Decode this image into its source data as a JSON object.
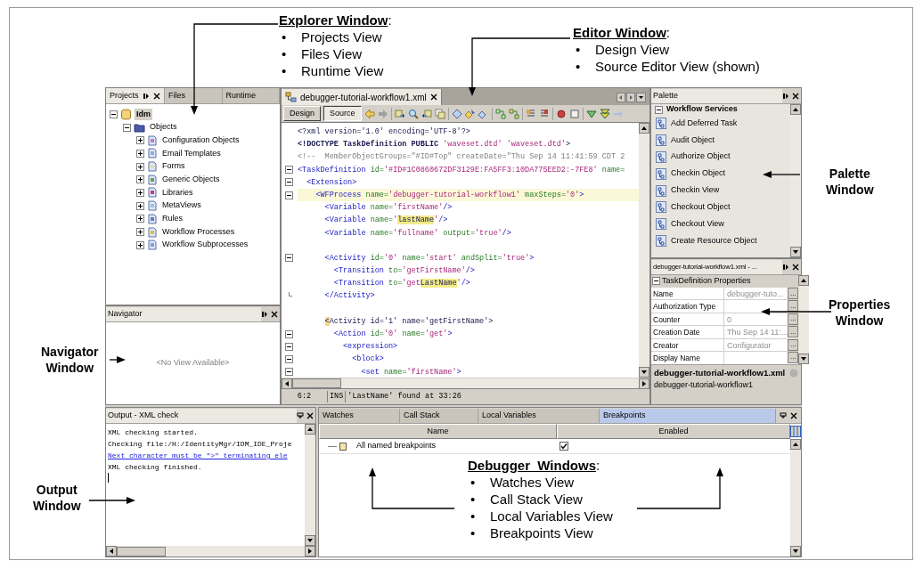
{
  "explorer": {
    "tabs": [
      {
        "label": "Projects",
        "selected": true
      },
      {
        "label": "Files",
        "selected": false
      },
      {
        "label": "Runtime",
        "selected": false
      }
    ],
    "tree": [
      {
        "label": "Idm",
        "expanded": true,
        "selected": true,
        "children": [
          {
            "label": "Objects",
            "expanded": true,
            "selected": false,
            "children": [
              {
                "label": "Configuration Objects",
                "expanded": false,
                "selected": false
              },
              {
                "label": "Email Templates",
                "expanded": false,
                "selected": false
              },
              {
                "label": "Forms",
                "expanded": false,
                "selected": false
              },
              {
                "label": "Generic Objects",
                "expanded": false,
                "selected": false
              },
              {
                "label": "Libraries",
                "expanded": false,
                "selected": false
              },
              {
                "label": "MetaViews",
                "expanded": false,
                "selected": false
              },
              {
                "label": "Rules",
                "expanded": false,
                "selected": false
              },
              {
                "label": "Workflow Processes",
                "expanded": false,
                "selected": false
              },
              {
                "label": "Workflow Subprocesses",
                "expanded": false,
                "selected": false
              }
            ]
          }
        ]
      }
    ]
  },
  "navigator": {
    "title": "Navigator",
    "empty_text": "<No View Available>"
  },
  "editor": {
    "file_tab": "debugger-tutorial-workflow1.xml",
    "view_tabs": [
      {
        "label": "Design",
        "selected": false
      },
      {
        "label": "Source",
        "selected": true
      }
    ],
    "lines": [
      {
        "tokens": [
          {
            "kind": "pi",
            "text": "<?xml version='1.0' encoding='UTF-8'?>"
          }
        ]
      },
      {
        "tokens": [
          {
            "kind": "doctype",
            "text": "<!DOCTYPE TaskDefinition PUBLIC "
          },
          {
            "kind": "value",
            "text": "'waveset.dtd' 'waveset.dtd'"
          },
          {
            "kind": "pi",
            "text": ">"
          }
        ]
      },
      {
        "tokens": [
          {
            "kind": "comment",
            "text": "<!--  MemberObjectGroups=\"#ID#Top\" createDate=\"Thu Sep 14 11:41:59 CDT 2"
          }
        ]
      },
      {
        "expanded": true,
        "tokens": [
          {
            "kind": "tag",
            "text": "<TaskDefinition"
          },
          {
            "kind": "attr",
            "text": " id="
          },
          {
            "kind": "value",
            "text": "'#ID#1C0860672DF3129E:FA5FF3:10DA775EED2:-7FE8'"
          },
          {
            "kind": "attr",
            "text": " name="
          }
        ]
      },
      {
        "expanded": true,
        "tokens": [
          {
            "kind": "tag",
            "text": "  <Extension>"
          }
        ]
      },
      {
        "expanded": true,
        "highlighted": true,
        "tokens": [
          {
            "kind": "tag",
            "text": "    <WFProcess"
          },
          {
            "kind": "attr",
            "text": " name="
          },
          {
            "kind": "value",
            "text": "'debugger-tutorial-workflow1'"
          },
          {
            "kind": "attr",
            "text": " maxSteps="
          },
          {
            "kind": "value",
            "text": "'0'"
          },
          {
            "kind": "tag",
            "text": ">"
          }
        ]
      },
      {
        "tokens": [
          {
            "kind": "tag",
            "text": "      <Variable"
          },
          {
            "kind": "attr",
            "text": " name="
          },
          {
            "kind": "value",
            "text": "'firstName'"
          },
          {
            "kind": "tag",
            "text": "/>"
          }
        ]
      },
      {
        "tokens": [
          {
            "kind": "tag",
            "text": "      <Variable"
          },
          {
            "kind": "attr",
            "text": " name="
          },
          {
            "kind": "value",
            "text": "'"
          },
          {
            "kind": "match",
            "text": "lastName"
          },
          {
            "kind": "value",
            "text": "'"
          },
          {
            "kind": "tag",
            "text": "/>"
          }
        ]
      },
      {
        "tokens": [
          {
            "kind": "tag",
            "text": "      <Variable"
          },
          {
            "kind": "attr",
            "text": " name="
          },
          {
            "kind": "value",
            "text": "'fullname'"
          },
          {
            "kind": "attr",
            "text": " output="
          },
          {
            "kind": "value",
            "text": "'true'"
          },
          {
            "kind": "tag",
            "text": "/>"
          }
        ]
      },
      {
        "expanded": true,
        "space_before": true,
        "tokens": [
          {
            "kind": "tag",
            "text": "      <Activity"
          },
          {
            "kind": "attr",
            "text": " id="
          },
          {
            "kind": "value",
            "text": "'0'"
          },
          {
            "kind": "attr",
            "text": " name="
          },
          {
            "kind": "value",
            "text": "'start'"
          },
          {
            "kind": "attr",
            "text": " andSplit="
          },
          {
            "kind": "value",
            "text": "'true'"
          },
          {
            "kind": "tag",
            "text": ">"
          }
        ]
      },
      {
        "tokens": [
          {
            "kind": "tag",
            "text": "        <Transition"
          },
          {
            "kind": "attr",
            "text": " to="
          },
          {
            "kind": "value",
            "text": "'getFirstName'"
          },
          {
            "kind": "tag",
            "text": "/>"
          }
        ]
      },
      {
        "tokens": [
          {
            "kind": "tag",
            "text": "        <Transition"
          },
          {
            "kind": "attr",
            "text": " to="
          },
          {
            "kind": "value",
            "text": "'get"
          },
          {
            "kind": "match",
            "text": "LastName"
          },
          {
            "kind": "value",
            "text": "'"
          },
          {
            "kind": "tag",
            "text": "/>"
          }
        ]
      },
      {
        "block_end": true,
        "tokens": [
          {
            "kind": "tag",
            "text": "      </Activity>"
          }
        ]
      },
      {
        "space_before": true,
        "tokens": [
          {
            "kind": "cursor",
            "text": "      <"
          },
          {
            "kind": "pi",
            "text": "Activity id="
          },
          {
            "kind": "pi",
            "text": "'1' name='getFirstName'>"
          }
        ]
      },
      {
        "expanded": true,
        "tokens": [
          {
            "kind": "tag",
            "text": "        <Action"
          },
          {
            "kind": "attr",
            "text": " id="
          },
          {
            "kind": "value",
            "text": "'0'"
          },
          {
            "kind": "attr",
            "text": " name="
          },
          {
            "kind": "value",
            "text": "'get'"
          },
          {
            "kind": "tag",
            "text": ">"
          }
        ]
      },
      {
        "expanded": true,
        "tokens": [
          {
            "kind": "tag",
            "text": "          <expression>"
          }
        ]
      },
      {
        "expanded": true,
        "tokens": [
          {
            "kind": "tag",
            "text": "            <block>"
          }
        ]
      },
      {
        "expanded": true,
        "tokens": [
          {
            "kind": "tag",
            "text": "              <set"
          },
          {
            "kind": "attr",
            "text": " name="
          },
          {
            "kind": "value",
            "text": "'firstName'"
          },
          {
            "kind": "tag",
            "text": ">"
          }
        ]
      }
    ],
    "status": {
      "position": "6:2",
      "mode": "INS",
      "message": "'LastName' found at 33:26"
    }
  },
  "palette": {
    "title": "Palette",
    "category": {
      "label": "Workflow Services",
      "expanded": true
    },
    "items": [
      "Add Deferred Task",
      "Audit Object",
      "Authorize Object",
      "Checkin Object",
      "Checkin View",
      "Checkout Object",
      "Checkout View",
      "Create Resource Object"
    ]
  },
  "properties": {
    "title": "debugger-tutorial-workflow1.xml - ...",
    "section": {
      "label": "TaskDefinition Properties",
      "expanded": true
    },
    "rows": [
      {
        "name": "Name",
        "value": "debugger-tuto...",
        "button": "..."
      },
      {
        "name": "Authorization Type",
        "button": "..."
      },
      {
        "name": "Counter",
        "value": "0",
        "button": "..."
      },
      {
        "name": "Creation Date",
        "value": "Thu Sep 14 11:...",
        "button": "..."
      },
      {
        "name": "Creator",
        "value": "Configurator",
        "button": "..."
      },
      {
        "name": "Display Name",
        "button": "..."
      }
    ],
    "description": {
      "title": "debugger-tutorial-workflow1.xml",
      "text": "debugger-tutorial-workflow1"
    }
  },
  "output": {
    "title": "Output - XML check",
    "lines": [
      {
        "kind": "text",
        "text": "XML checking started."
      },
      {
        "kind": "text",
        "text": "Checking file:/H:/IdentityMgr/IDM_IDE_Proje"
      },
      {
        "kind": "link",
        "text": "Next character must be \">\" terminating ele"
      },
      {
        "kind": "text",
        "text": "XML checking finished."
      }
    ]
  },
  "debugger": {
    "tabs": [
      {
        "label": "Watches",
        "selected": false
      },
      {
        "label": "Call Stack",
        "selected": false
      },
      {
        "label": "Local Variables",
        "selected": false
      },
      {
        "label": "Breakpoints",
        "selected": true
      }
    ],
    "columns": [
      "Name",
      "Enabled"
    ],
    "rows": [
      {
        "name": "All named breakpoints",
        "enabled": true
      }
    ]
  },
  "callouts": [
    {
      "kind": "list",
      "title": "Explorer Window",
      "suffix": ":",
      "items": [
        {
          "bullet": "•",
          "text": "Projects View"
        },
        {
          "bullet": "•",
          "text": "Files View"
        },
        {
          "bullet": "•",
          "text": "Runtime View"
        }
      ]
    },
    {
      "kind": "list",
      "title": "Editor Window",
      "suffix": ":",
      "items": [
        {
          "bullet": "•",
          "text": "Design View"
        },
        {
          "bullet": "•",
          "text": "Source Editor View (shown)"
        }
      ]
    },
    {
      "kind": "label",
      "title": "Palette Window"
    },
    {
      "kind": "label",
      "title": "Properties Window"
    },
    {
      "kind": "label",
      "title": "Navigator Window"
    },
    {
      "kind": "label",
      "title": "Output Window"
    },
    {
      "kind": "list",
      "title": "Debugger  Windows",
      "suffix": ":",
      "items": [
        {
          "bullet": "•",
          "text": "Watches View"
        },
        {
          "bullet": "•",
          "text": "Call Stack View"
        },
        {
          "bullet": "•",
          "text": "Local Variables View"
        },
        {
          "bullet": "•",
          "text": "Breakpoints View"
        }
      ]
    }
  ]
}
